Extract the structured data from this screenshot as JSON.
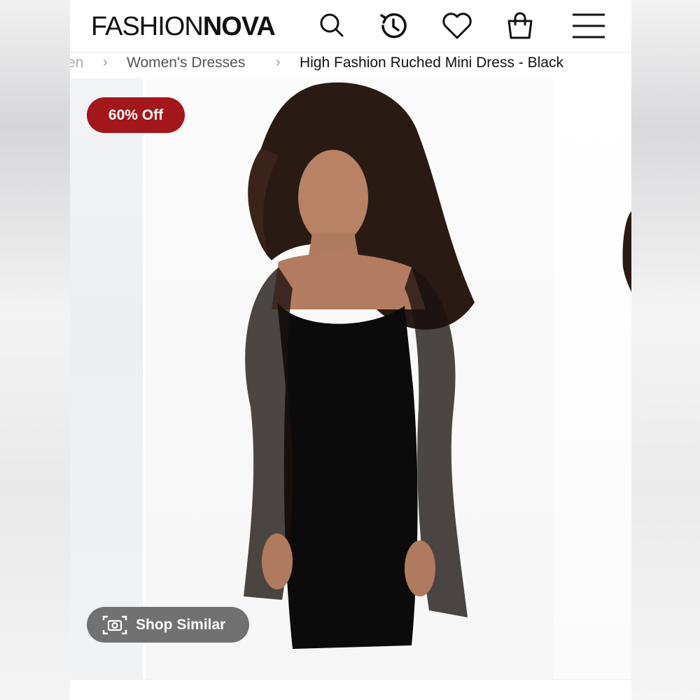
{
  "header": {
    "logo_part1": "FASHION",
    "logo_part2": "NOVA",
    "icons": [
      "search-icon",
      "history-icon",
      "heart-icon",
      "bag-icon",
      "menu-icon"
    ]
  },
  "breadcrumb": {
    "items": [
      "en",
      "Women's Dresses",
      "High Fashion Ruched Mini Dress - Black"
    ]
  },
  "product": {
    "discount_badge": "60% Off",
    "shop_similar_label": "Shop Similar"
  },
  "colors": {
    "badge": "#a3161b",
    "text": "#111111",
    "dress": "#0b0b0b"
  }
}
